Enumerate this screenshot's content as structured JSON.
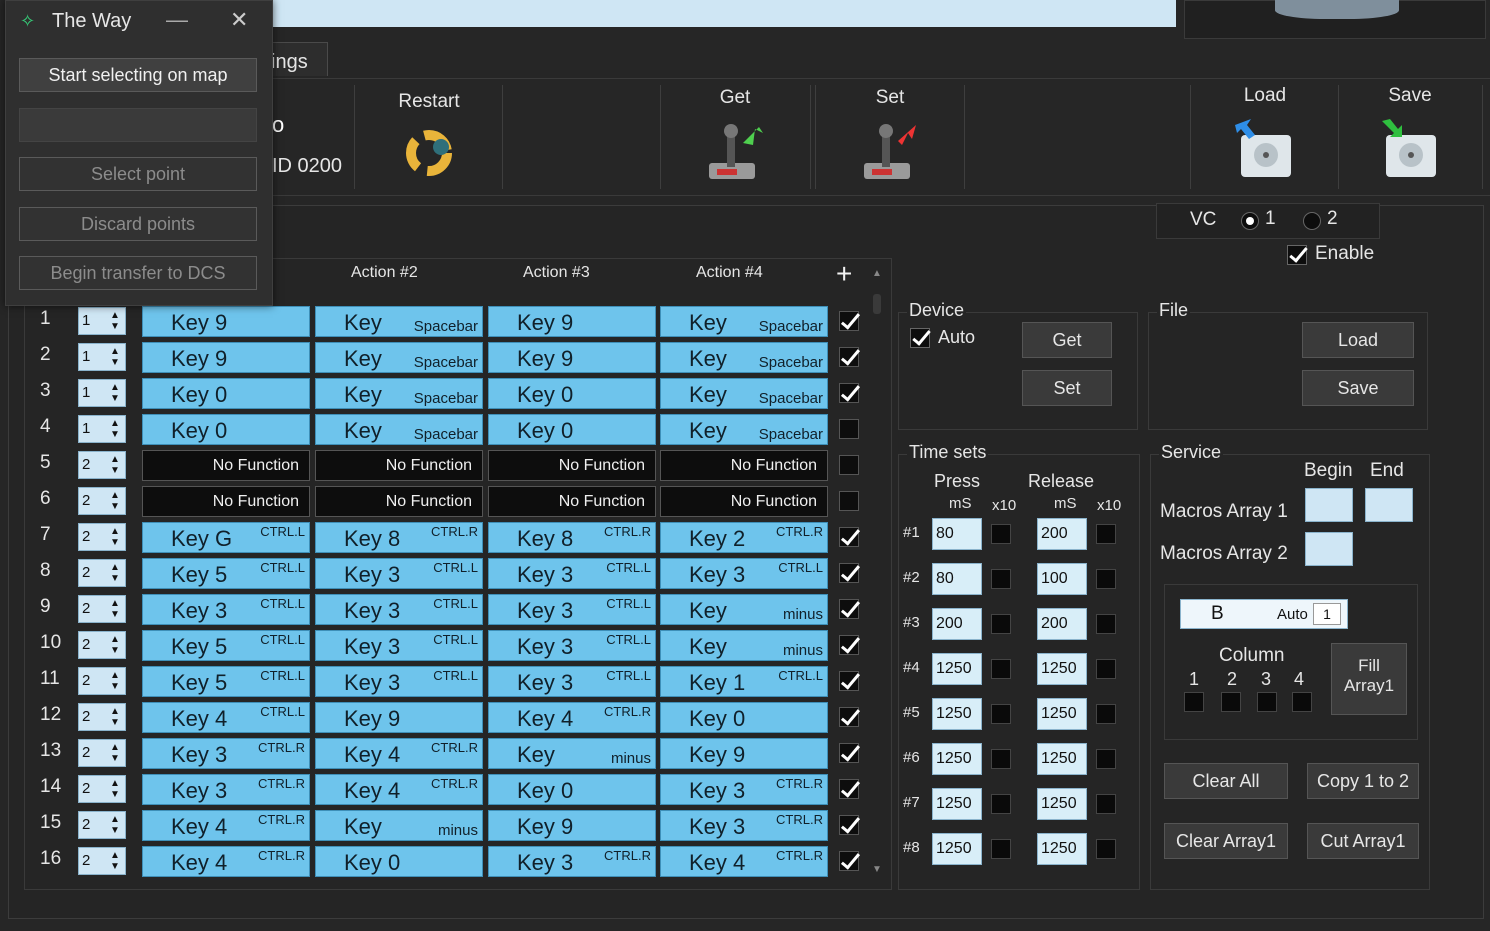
{
  "overlay": {
    "title": "The Way",
    "start_label": "Start selecting on map",
    "select_point_label": "Select point",
    "discard_label": "Discard points",
    "transfer_label": "Begin transfer to DCS"
  },
  "tab": {
    "label": "ings"
  },
  "device": {
    "name_partial": "o",
    "id_partial": "ID 0200"
  },
  "toolbar": {
    "restart": "Restart",
    "get": "Get",
    "set": "Set",
    "load": "Load",
    "save": "Save"
  },
  "columns": {
    "action2": "Action #2",
    "action3": "Action #3",
    "action4": "Action #4"
  },
  "rows": [
    {
      "n": "1",
      "spin": "1",
      "checked": true,
      "cells": [
        {
          "t": "key",
          "main": "Key 9"
        },
        {
          "t": "key",
          "main": "Key",
          "sub": "Spacebar"
        },
        {
          "t": "key",
          "main": "Key 9"
        },
        {
          "t": "key",
          "main": "Key",
          "sub": "Spacebar"
        }
      ]
    },
    {
      "n": "2",
      "spin": "1",
      "checked": true,
      "cells": [
        {
          "t": "key",
          "main": "Key 9"
        },
        {
          "t": "key",
          "main": "Key",
          "sub": "Spacebar"
        },
        {
          "t": "key",
          "main": "Key 9"
        },
        {
          "t": "key",
          "main": "Key",
          "sub": "Spacebar"
        }
      ]
    },
    {
      "n": "3",
      "spin": "1",
      "checked": true,
      "cells": [
        {
          "t": "key",
          "main": "Key 0"
        },
        {
          "t": "key",
          "main": "Key",
          "sub": "Spacebar"
        },
        {
          "t": "key",
          "main": "Key 0"
        },
        {
          "t": "key",
          "main": "Key",
          "sub": "Spacebar"
        }
      ]
    },
    {
      "n": "4",
      "spin": "1",
      "checked": false,
      "cells": [
        {
          "t": "key",
          "main": "Key 0"
        },
        {
          "t": "key",
          "main": "Key",
          "sub": "Spacebar"
        },
        {
          "t": "key",
          "main": "Key 0"
        },
        {
          "t": "key",
          "main": "Key",
          "sub": "Spacebar"
        }
      ]
    },
    {
      "n": "5",
      "spin": "2",
      "checked": false,
      "cells": [
        {
          "t": "nf",
          "main": "No Function"
        },
        {
          "t": "nf",
          "main": "No Function"
        },
        {
          "t": "nf",
          "main": "No Function"
        },
        {
          "t": "nf",
          "main": "No Function"
        }
      ]
    },
    {
      "n": "6",
      "spin": "2",
      "checked": false,
      "cells": [
        {
          "t": "nf",
          "main": "No Function"
        },
        {
          "t": "nf",
          "main": "No Function"
        },
        {
          "t": "nf",
          "main": "No Function"
        },
        {
          "t": "nf",
          "main": "No Function"
        }
      ]
    },
    {
      "n": "7",
      "spin": "2",
      "checked": true,
      "cells": [
        {
          "t": "key",
          "main": "Key G",
          "mod": "CTRL.L"
        },
        {
          "t": "key",
          "main": "Key 8",
          "mod": "CTRL.R"
        },
        {
          "t": "key",
          "main": "Key 8",
          "mod": "CTRL.R"
        },
        {
          "t": "key",
          "main": "Key 2",
          "mod": "CTRL.R"
        }
      ]
    },
    {
      "n": "8",
      "spin": "2",
      "checked": true,
      "cells": [
        {
          "t": "key",
          "main": "Key 5",
          "mod": "CTRL.L"
        },
        {
          "t": "key",
          "main": "Key 3",
          "mod": "CTRL.L"
        },
        {
          "t": "key",
          "main": "Key 3",
          "mod": "CTRL.L"
        },
        {
          "t": "key",
          "main": "Key 3",
          "mod": "CTRL.L"
        }
      ]
    },
    {
      "n": "9",
      "spin": "2",
      "checked": true,
      "cells": [
        {
          "t": "key",
          "main": "Key 3",
          "mod": "CTRL.L"
        },
        {
          "t": "key",
          "main": "Key 3",
          "mod": "CTRL.L"
        },
        {
          "t": "key",
          "main": "Key 3",
          "mod": "CTRL.L"
        },
        {
          "t": "key",
          "main": "Key",
          "sub": "minus"
        }
      ]
    },
    {
      "n": "10",
      "spin": "2",
      "checked": true,
      "cells": [
        {
          "t": "key",
          "main": "Key 5",
          "mod": "CTRL.L"
        },
        {
          "t": "key",
          "main": "Key 3",
          "mod": "CTRL.L"
        },
        {
          "t": "key",
          "main": "Key 3",
          "mod": "CTRL.L"
        },
        {
          "t": "key",
          "main": "Key",
          "sub": "minus"
        }
      ]
    },
    {
      "n": "11",
      "spin": "2",
      "checked": true,
      "cells": [
        {
          "t": "key",
          "main": "Key 5",
          "mod": "CTRL.L"
        },
        {
          "t": "key",
          "main": "Key 3",
          "mod": "CTRL.L"
        },
        {
          "t": "key",
          "main": "Key 3",
          "mod": "CTRL.L"
        },
        {
          "t": "key",
          "main": "Key 1",
          "mod": "CTRL.L"
        }
      ]
    },
    {
      "n": "12",
      "spin": "2",
      "checked": true,
      "cells": [
        {
          "t": "key",
          "main": "Key 4",
          "mod": "CTRL.L"
        },
        {
          "t": "key",
          "main": "Key 9"
        },
        {
          "t": "key",
          "main": "Key 4",
          "mod": "CTRL.R"
        },
        {
          "t": "key",
          "main": "Key 0"
        }
      ]
    },
    {
      "n": "13",
      "spin": "2",
      "checked": true,
      "cells": [
        {
          "t": "key",
          "main": "Key 3",
          "mod": "CTRL.R"
        },
        {
          "t": "key",
          "main": "Key 4",
          "mod": "CTRL.R"
        },
        {
          "t": "key",
          "main": "Key",
          "sub": "minus"
        },
        {
          "t": "key",
          "main": "Key 9"
        }
      ]
    },
    {
      "n": "14",
      "spin": "2",
      "checked": true,
      "cells": [
        {
          "t": "key",
          "main": "Key 3",
          "mod": "CTRL.R"
        },
        {
          "t": "key",
          "main": "Key 4",
          "mod": "CTRL.R"
        },
        {
          "t": "key",
          "main": "Key 0"
        },
        {
          "t": "key",
          "main": "Key 3",
          "mod": "CTRL.R"
        }
      ]
    },
    {
      "n": "15",
      "spin": "2",
      "checked": true,
      "cells": [
        {
          "t": "key",
          "main": "Key 4",
          "mod": "CTRL.R"
        },
        {
          "t": "key",
          "main": "Key",
          "sub": "minus"
        },
        {
          "t": "key",
          "main": "Key 9"
        },
        {
          "t": "key",
          "main": "Key 3",
          "mod": "CTRL.R"
        }
      ]
    },
    {
      "n": "16",
      "spin": "2",
      "checked": true,
      "cells": [
        {
          "t": "key",
          "main": "Key 4",
          "mod": "CTRL.R"
        },
        {
          "t": "key",
          "main": "Key 0"
        },
        {
          "t": "key",
          "main": "Key 3",
          "mod": "CTRL.R"
        },
        {
          "t": "key",
          "main": "Key 4",
          "mod": "CTRL.R"
        }
      ]
    }
  ],
  "vc": {
    "label": "VC",
    "opt1": "1",
    "opt2": "2",
    "enable": "Enable"
  },
  "devicegroup": {
    "title": "Device",
    "auto": "Auto",
    "get": "Get",
    "set": "Set"
  },
  "filegroup": {
    "title": "File",
    "load": "Load",
    "save": "Save"
  },
  "timesets": {
    "title": "Time sets",
    "press": "Press",
    "release": "Release",
    "ms": "mS",
    "x10": "x10",
    "rows": [
      {
        "id": "#1",
        "press": "80",
        "release": "200"
      },
      {
        "id": "#2",
        "press": "80",
        "release": "100"
      },
      {
        "id": "#3",
        "press": "200",
        "release": "200"
      },
      {
        "id": "#4",
        "press": "1250",
        "release": "1250"
      },
      {
        "id": "#5",
        "press": "1250",
        "release": "1250"
      },
      {
        "id": "#6",
        "press": "1250",
        "release": "1250"
      },
      {
        "id": "#7",
        "press": "1250",
        "release": "1250"
      },
      {
        "id": "#8",
        "press": "1250",
        "release": "1250"
      }
    ]
  },
  "service": {
    "title": "Service",
    "begin": "Begin",
    "end": "End",
    "macros1": "Macros Array 1",
    "macros2": "Macros Array 2",
    "b_label": "B",
    "auto_label": "Auto",
    "auto_value": "1",
    "column": "Column",
    "col1": "1",
    "col2": "2",
    "col3": "3",
    "col4": "4",
    "fill1": "Fill",
    "fill2": "Array1",
    "clear_all": "Clear All",
    "copy": "Copy 1 to 2",
    "clear_array": "Clear Array1",
    "cut_array": "Cut Array1"
  }
}
